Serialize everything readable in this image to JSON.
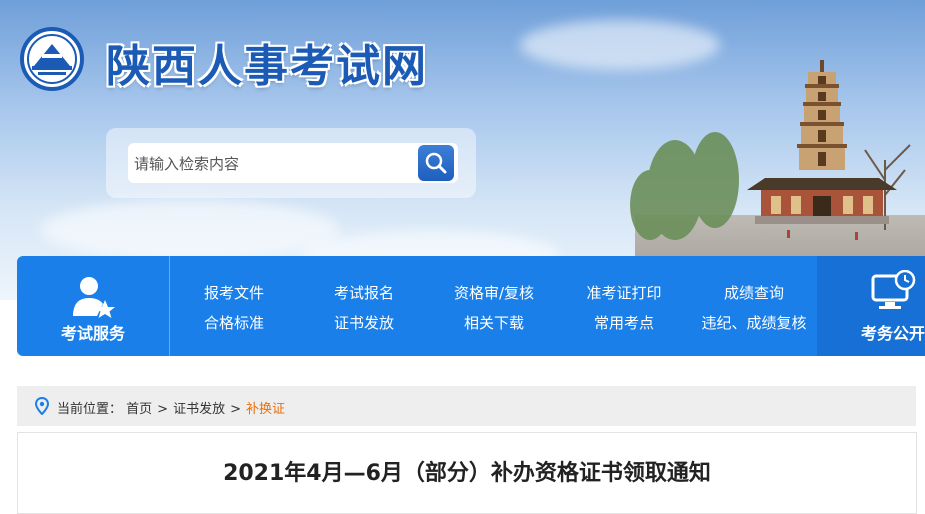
{
  "header": {
    "site_title": "陕西人事考试网"
  },
  "search": {
    "placeholder": "请输入检索内容"
  },
  "nav": {
    "left_label": "考试服务",
    "right_label": "考务公开",
    "items_row1": [
      "报考文件",
      "考试报名",
      "资格审/复核",
      "准考证打印",
      "成绩查询"
    ],
    "items_row2": [
      "合格标准",
      "证书发放",
      "相关下载",
      "常用考点",
      "违纪、成绩复核"
    ]
  },
  "breadcrumb": {
    "prefix": "当前位置：",
    "items": [
      "首页",
      "证书发放"
    ],
    "current": "补换证"
  },
  "article": {
    "title": "2021年4月—6月（部分）补办资格证书领取通知"
  },
  "colors": {
    "nav_blue": "#1a7fe8",
    "title_blue": "#1c5bb5",
    "crumb_current": "#e8710a"
  }
}
